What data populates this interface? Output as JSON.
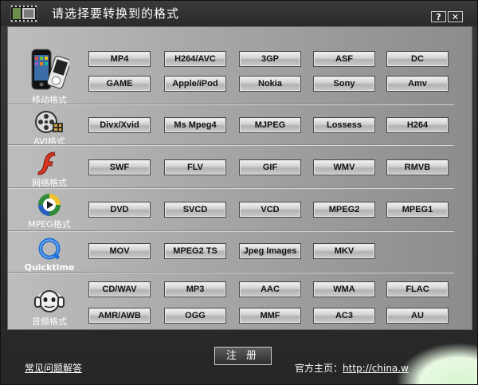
{
  "window": {
    "title": "请选择要转换到的格式",
    "help_button": "?",
    "close_button": "✕"
  },
  "categories": [
    {
      "label": "移动格式",
      "icon": "mobile-phone-icon",
      "formats": [
        "MP4",
        "H264/AVC",
        "3GP",
        "ASF",
        "DC",
        "GAME",
        "Apple/iPod",
        "Nokia",
        "Sony",
        "Amv"
      ]
    },
    {
      "label": "AVI格式",
      "icon": "film-reel-icon",
      "formats": [
        "Divx/Xvid",
        "Ms Mpeg4",
        "MJPEG",
        "Lossess",
        "H264"
      ]
    },
    {
      "label": "网络格式",
      "icon": "flash-icon",
      "formats": [
        "SWF",
        "FLV",
        "GIF",
        "WMV",
        "RMVB"
      ]
    },
    {
      "label": "MPEG格式",
      "icon": "mpeg-disc-icon",
      "formats": [
        "DVD",
        "SVCD",
        "VCD",
        "MPEG2",
        "MPEG1"
      ]
    },
    {
      "label": "Quicktime",
      "icon": "quicktime-icon",
      "formats": [
        "MOV",
        "MPEG2 TS",
        "Jpeg Images",
        "MKV"
      ]
    },
    {
      "label": "音频格式",
      "icon": "napster-headphones-icon",
      "formats": [
        "CD/WAV",
        "MP3",
        "AAC",
        "WMA",
        "FLAC",
        "AMR/AWB",
        "OGG",
        "MMF",
        "AC3",
        "AU"
      ]
    }
  ],
  "footer": {
    "register_label": "注 册",
    "faq_link": "常见问题解答",
    "homepage_label": "官方主页：",
    "homepage_url": "http://china.w"
  },
  "colors": {
    "titlebar": "#2a2a2a",
    "panel": "#a8a8a8",
    "button_face": "#d0d0d0",
    "text_light": "#ffffff"
  }
}
